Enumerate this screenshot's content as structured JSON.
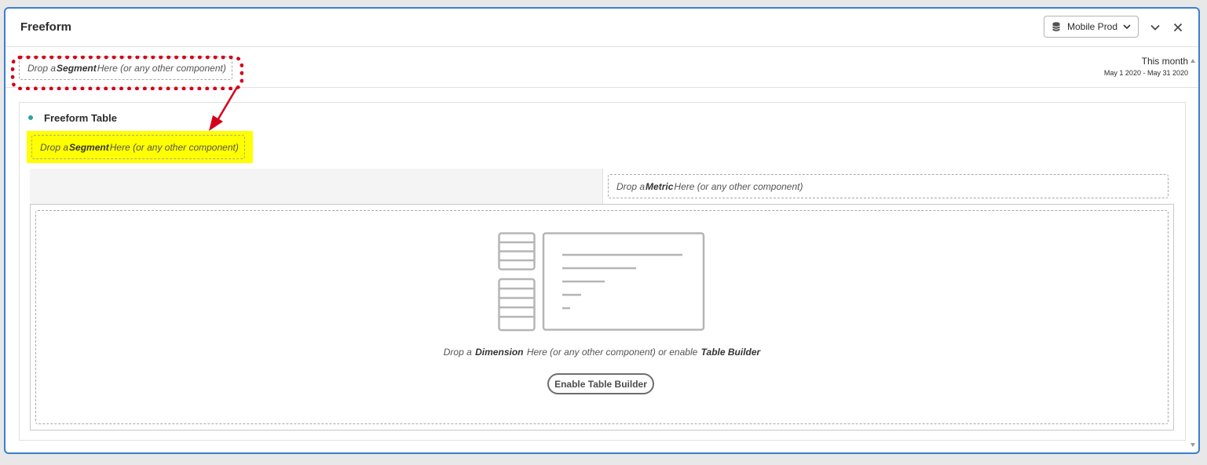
{
  "panel": {
    "title": "Freeform",
    "report_suite": "Mobile Prod",
    "collapse_icon": "chevron-down-icon",
    "close_icon": "close-icon"
  },
  "panel_segment_drop": {
    "prefix": "Drop a ",
    "emphasis": "Segment",
    "suffix": " Here (or any other component)"
  },
  "date": {
    "label": "This month",
    "range": "May 1 2020 - May 31 2020"
  },
  "viz": {
    "title": "Freeform Table",
    "segment_drop": {
      "prefix": "Drop a ",
      "emphasis": "Segment",
      "suffix": " Here (or any other component)"
    },
    "metric_drop": {
      "prefix": "Drop a ",
      "emphasis": "Metric",
      "suffix": " Here (or any other component)"
    },
    "dimension_drop": {
      "prefix": "Drop a ",
      "emphasis": "Dimension",
      "middle": " Here (or any other component) or enable ",
      "emphasis2": "Table Builder"
    },
    "enable_button": "Enable Table Builder"
  },
  "annotations": {
    "highlight_color": "#ffff00",
    "callout_color": "#d4001a"
  }
}
